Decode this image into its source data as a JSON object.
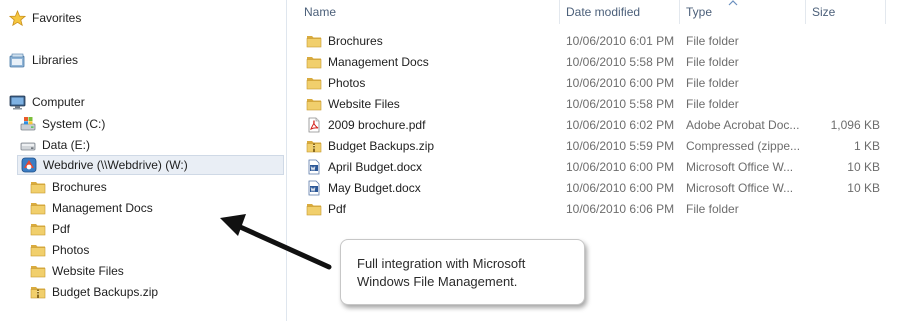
{
  "nav": {
    "favorites": "Favorites",
    "libraries": "Libraries",
    "computer": "Computer",
    "drives": [
      {
        "label": "System (C:)",
        "icon": "windows-drive-icon"
      },
      {
        "label": "Data (E:)",
        "icon": "drive-icon"
      },
      {
        "label": "Webdrive (\\\\Webdrive) (W:)",
        "icon": "network-drive-icon"
      }
    ],
    "webdrive_children": [
      {
        "label": "Brochures",
        "icon": "folder-icon"
      },
      {
        "label": "Management Docs",
        "icon": "folder-icon"
      },
      {
        "label": "Pdf",
        "icon": "folder-icon"
      },
      {
        "label": "Photos",
        "icon": "folder-icon"
      },
      {
        "label": "Website Files",
        "icon": "folder-icon"
      },
      {
        "label": "Budget Backups.zip",
        "icon": "zip-folder-icon"
      }
    ]
  },
  "columns": {
    "name": "Name",
    "date_modified": "Date modified",
    "type": "Type",
    "size": "Size"
  },
  "files": [
    {
      "name": "Brochures",
      "date": "10/06/2010 6:01 PM",
      "type": "File folder",
      "size": "",
      "icon": "folder-icon"
    },
    {
      "name": "Management Docs",
      "date": "10/06/2010 5:58 PM",
      "type": "File folder",
      "size": "",
      "icon": "folder-icon"
    },
    {
      "name": "Photos",
      "date": "10/06/2010 6:00 PM",
      "type": "File folder",
      "size": "",
      "icon": "folder-icon"
    },
    {
      "name": "Website Files",
      "date": "10/06/2010 5:58 PM",
      "type": "File folder",
      "size": "",
      "icon": "folder-icon"
    },
    {
      "name": "2009 brochure.pdf",
      "date": "10/06/2010 6:02 PM",
      "type": "Adobe Acrobat Doc...",
      "size": "1,096 KB",
      "icon": "pdf-file-icon"
    },
    {
      "name": "Budget Backups.zip",
      "date": "10/06/2010 5:59 PM",
      "type": "Compressed (zippe...",
      "size": "1 KB",
      "icon": "zip-folder-icon"
    },
    {
      "name": "April Budget.docx",
      "date": "10/06/2010 6:00 PM",
      "type": "Microsoft Office W...",
      "size": "10 KB",
      "icon": "word-document-icon"
    },
    {
      "name": "May Budget.docx",
      "date": "10/06/2010 6:00 PM",
      "type": "Microsoft Office W...",
      "size": "10 KB",
      "icon": "word-document-icon"
    },
    {
      "name": "Pdf",
      "date": "10/06/2010 6:06 PM",
      "type": "File folder",
      "size": "",
      "icon": "folder-icon"
    }
  ],
  "callout": {
    "line1": "Full integration with Microsoft",
    "line2": "Windows File Management."
  },
  "colors": {
    "folder": "#e8c25a",
    "header_text": "#4c607a",
    "selected_bg": "#e9eef5",
    "arrow": "#111111"
  }
}
